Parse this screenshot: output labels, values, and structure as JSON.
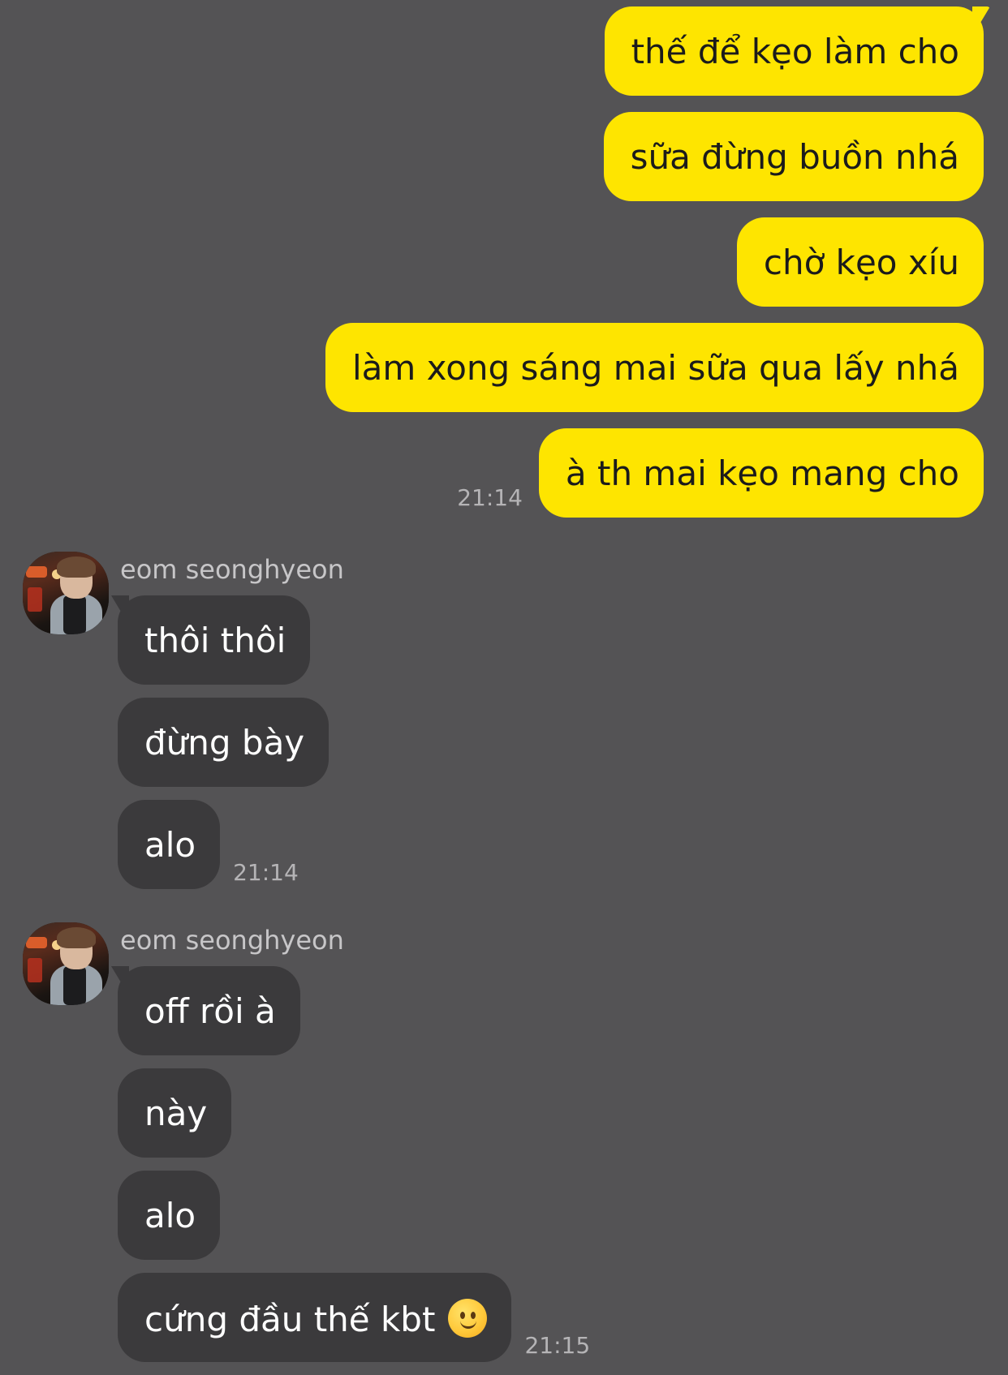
{
  "outgoing": {
    "messages": [
      "thế để kẹo làm cho",
      "sữa đừng buồn nhá",
      "chờ kẹo xíu",
      "làm xong sáng mai sữa qua lấy nhá",
      "à th mai kẹo mang cho"
    ],
    "time": "21:14"
  },
  "incoming": [
    {
      "sender": "eom seonghyeon",
      "avatar_icon": "profile-photo-avatar",
      "messages": [
        "thôi thôi",
        "đừng bày",
        "alo"
      ],
      "time": "21:14"
    },
    {
      "sender": "eom seonghyeon",
      "avatar_icon": "profile-photo-avatar",
      "messages": [
        "off rồi à",
        "này",
        "alo",
        "cứng đầu thế kbt"
      ],
      "emoji": "slightly-smiling-face-emoji",
      "time": "21:15"
    }
  ],
  "colors": {
    "background": "#545355",
    "outgoing_bubble": "#FEE500",
    "incoming_bubble": "#3b3a3c",
    "timestamp": "#b5b4b6"
  }
}
